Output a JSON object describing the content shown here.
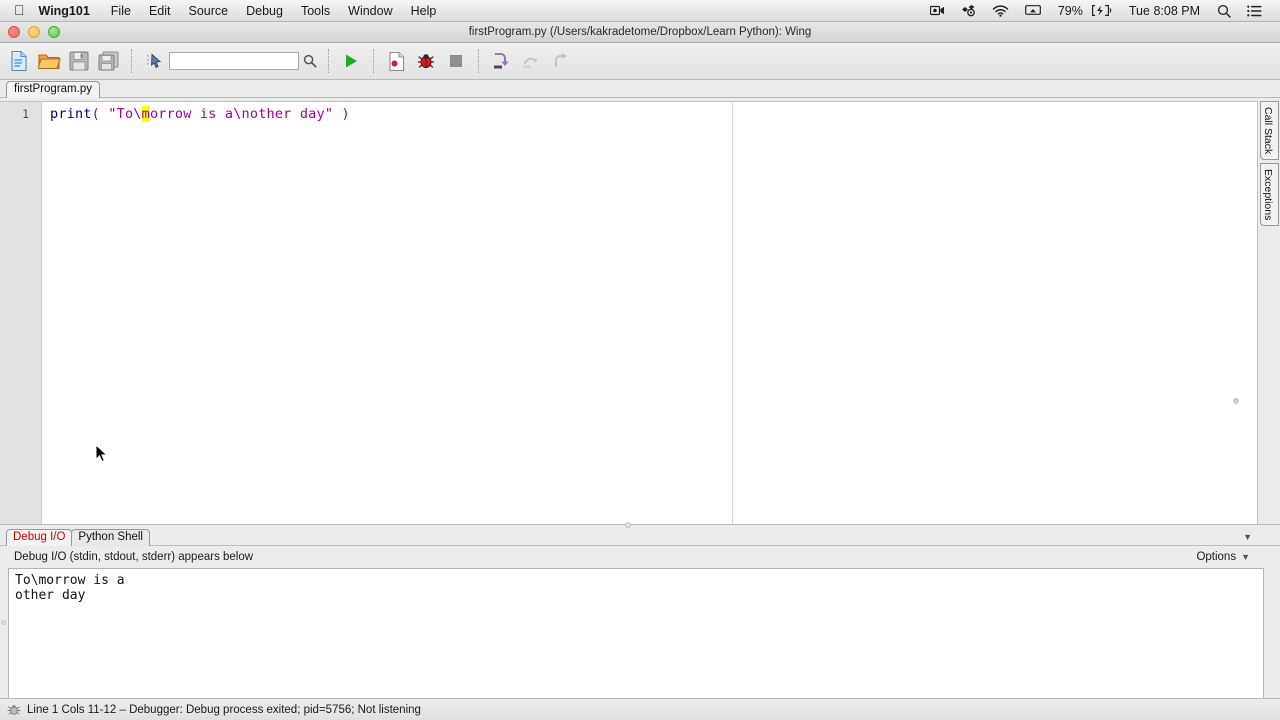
{
  "menubar": {
    "apple_icon": "apple-logo-icon",
    "app_name": "Wing101",
    "items": [
      "File",
      "Edit",
      "Source",
      "Debug",
      "Tools",
      "Window",
      "Help"
    ],
    "status_icons": [
      "screen-recording-icon",
      "dropbox-sync-icon",
      "wifi-icon",
      "airplay-icon"
    ],
    "battery_percent": "79%",
    "battery_icon": "battery-charging-icon",
    "clock": "Tue 8:08 PM",
    "search_icon": "spotlight-search-icon",
    "notification_icon": "notification-center-icon"
  },
  "window": {
    "title": "firstProgram.py (/Users/kakradetome/Dropbox/Learn Python): Wing",
    "traffic_lights": [
      "close-button",
      "minimize-button",
      "zoom-button"
    ]
  },
  "toolbar": {
    "buttons": [
      {
        "name": "new-file-button",
        "label": "New File"
      },
      {
        "name": "open-file-button",
        "label": "Open File"
      },
      {
        "name": "save-file-button",
        "label": "Save"
      },
      {
        "name": "save-all-button",
        "label": "Save All"
      },
      {
        "name": "select-tool-button",
        "label": "Select"
      },
      {
        "name": "run-button",
        "label": "Run"
      },
      {
        "name": "debug-file-button",
        "label": "Debug File"
      },
      {
        "name": "debug-button",
        "label": "Debug"
      },
      {
        "name": "stop-button",
        "label": "Stop"
      },
      {
        "name": "step-into-button",
        "label": "Step Into"
      },
      {
        "name": "step-over-button",
        "label": "Step Over"
      },
      {
        "name": "step-out-button",
        "label": "Step Out"
      }
    ],
    "search": {
      "value": "",
      "placeholder": ""
    }
  },
  "editor": {
    "file_tab": "firstProgram.py",
    "nav_back": "◀",
    "nav_forward": "▶",
    "header_icons": [
      "pin-icon",
      "chevron-down-icon",
      "close-icon"
    ],
    "gutter": {
      "line_numbers": [
        "1"
      ]
    },
    "code": {
      "line_number": "1",
      "tokens": [
        {
          "text": "print",
          "type": "keyword"
        },
        {
          "text": "(",
          "type": "paren"
        },
        {
          "text": " ",
          "type": "plain"
        },
        {
          "text": "\"To\\",
          "type": "string"
        },
        {
          "text": "m",
          "type": "cursor"
        },
        {
          "text": "orrow is a\\nother day\"",
          "type": "string"
        },
        {
          "text": " ",
          "type": "plain"
        },
        {
          "text": ")",
          "type": "paren"
        }
      ],
      "plain_text": "print( \"To\\morrow is a\\nother day\" )"
    }
  },
  "right_tabs": [
    {
      "name": "tab-call-stack",
      "label": "Call Stack"
    },
    {
      "name": "tab-exceptions",
      "label": "Exceptions"
    }
  ],
  "bottom_panel": {
    "tabs": [
      {
        "name": "tab-debug-io",
        "label": "Debug I/O",
        "active": true
      },
      {
        "name": "tab-python-shell",
        "label": "Python Shell",
        "active": false
      }
    ],
    "collapse_caret": "▼",
    "description": "Debug I/O (stdin, stdout, stderr) appears below",
    "options_label": "Options",
    "options_caret": "▼",
    "output_lines": [
      "To\\morrow is a",
      "other day"
    ],
    "scroll_caret": "▼"
  },
  "statusbar": {
    "icon": "bug-icon",
    "text": "Line 1 Cols 11-12 – Debugger: Debug process exited; pid=5756; Not listening"
  },
  "colors": {
    "keyword": "#00007f",
    "string": "#a000a0",
    "cursor_highlight": "#ffff00",
    "active_tab_text": "#cc0000",
    "run_green": "#22aa22",
    "close_red": "#cc2222"
  }
}
